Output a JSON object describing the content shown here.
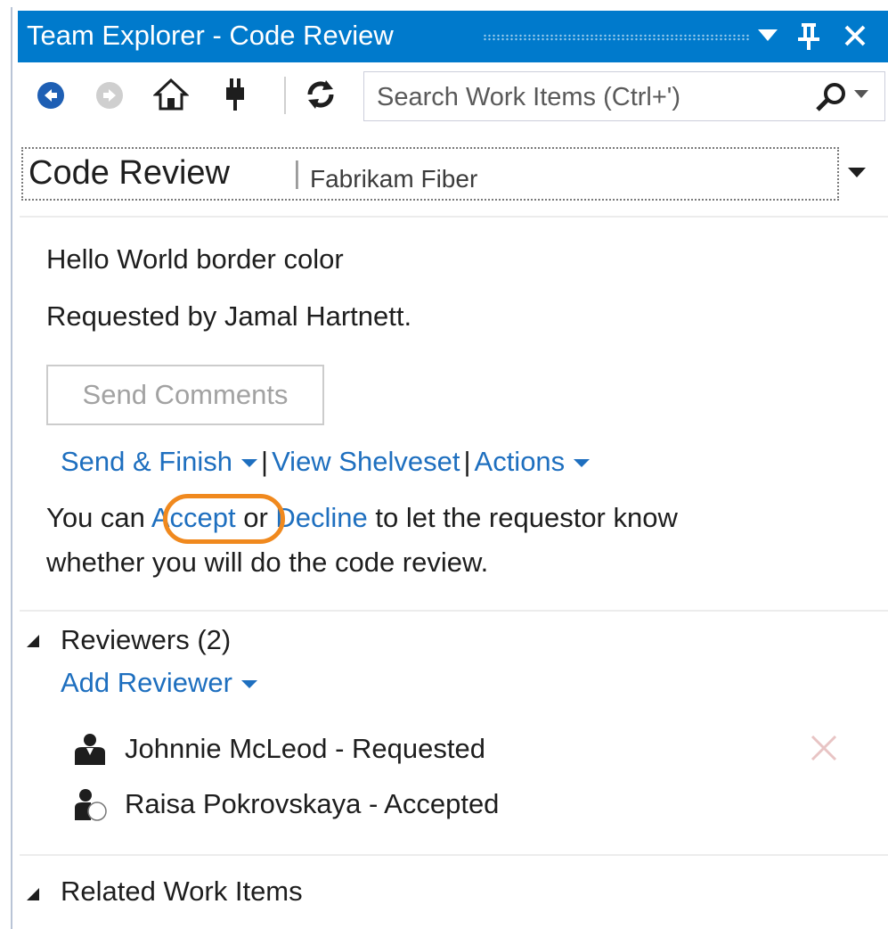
{
  "window": {
    "title": "Team Explorer - Code Review",
    "buttons": {
      "dropdown": "▾",
      "pin": "⊥",
      "close": "✕"
    }
  },
  "toolbar": {
    "icons": [
      "back-arrow-icon",
      "forward-arrow-icon",
      "home-icon",
      "plug-icon",
      "refresh-icon"
    ],
    "search_placeholder": "Search Work Items (Ctrl+')"
  },
  "header": {
    "title": "Code Review",
    "separator": "|",
    "project": "Fabrikam Fiber"
  },
  "review": {
    "name": "Hello World border color",
    "requested_by": "Requested by Jamal Hartnett.",
    "send_comments_label": "Send Comments",
    "links": {
      "send_finish": "Send & Finish",
      "view_shelveset": "View Shelveset",
      "actions": "Actions",
      "sep": "|"
    },
    "message": {
      "prefix": "You can ",
      "accept": "Accept",
      "middle": " or ",
      "decline": "Decline",
      "suffix": " to let the requestor know",
      "line2": "whether you will do the code review."
    }
  },
  "reviewers": {
    "heading": "Reviewers (2)",
    "add_label": "Add Reviewer",
    "items": [
      {
        "name": "Johnnie McLeod - Requested"
      },
      {
        "name": "Raisa Pokrovskaya - Accepted"
      }
    ]
  },
  "related": {
    "heading": "Related Work Items"
  },
  "colors": {
    "accent": "#007acc",
    "link": "#1e6fbf",
    "highlight": "#f0891e"
  }
}
